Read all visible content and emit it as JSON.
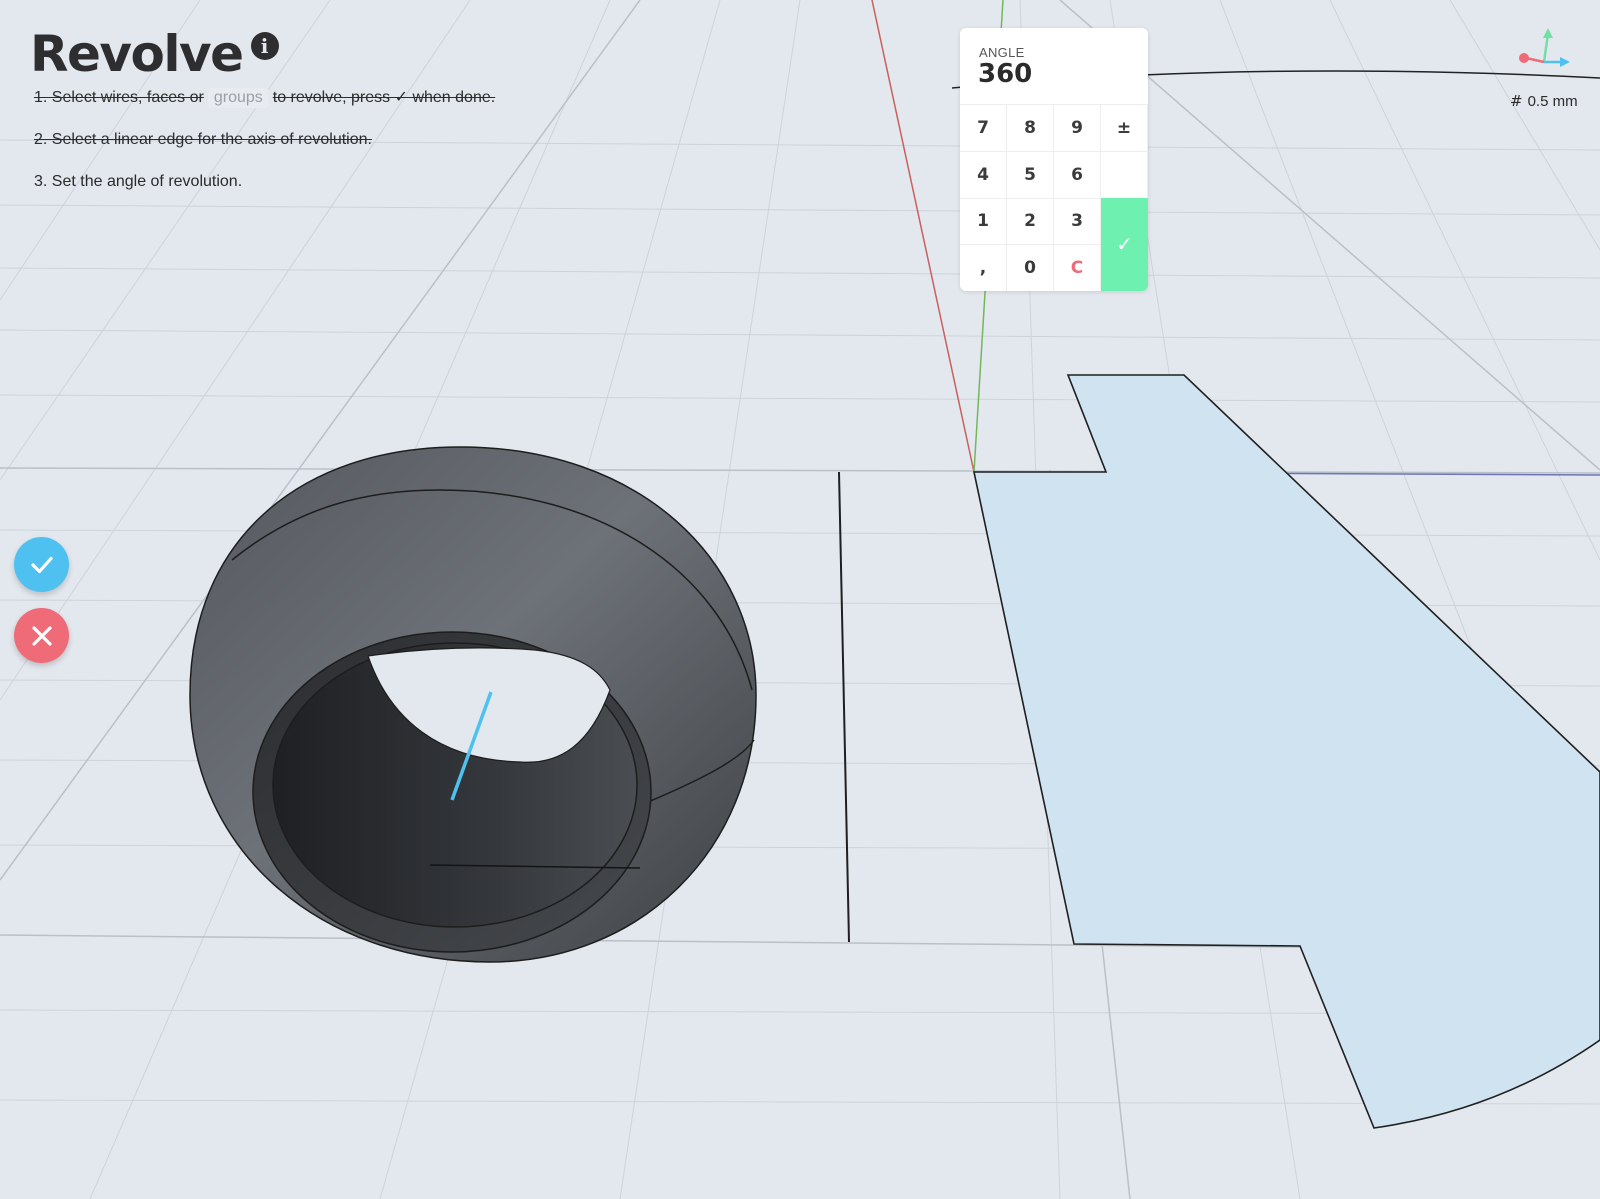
{
  "header": {
    "title": "Revolve",
    "info_icon": "info-icon"
  },
  "steps": {
    "step1_a": "1. Select wires, faces or",
    "step1_chip": "groups",
    "step1_b": "to revolve, press ✓ when done.",
    "step2": "2. Select a linear edge for the axis of revolution.",
    "step3": "3. Set the angle of revolution."
  },
  "actions": {
    "confirm_icon": "checkmark-icon",
    "cancel_icon": "close-icon",
    "confirm_color": "#4fc1f0",
    "cancel_color": "#ef6b78"
  },
  "keypad": {
    "label": "ANGLE",
    "value": "360",
    "keys": {
      "k7": "7",
      "k8": "8",
      "k9": "9",
      "kpm": "±",
      "k4": "4",
      "k5": "5",
      "k6": "6",
      "k1": "1",
      "k2": "2",
      "k3": "3",
      "kcomma": ",",
      "k0": "0",
      "kclear": "C",
      "kconfirm": "✓"
    },
    "confirm_color": "#6ef0b1"
  },
  "status": {
    "grid_icon": "grid-icon",
    "grid_symbol": "#",
    "grid_size": "0.5 mm"
  },
  "colors": {
    "background": "#e3e8ee",
    "axis_x": "#c8605c",
    "axis_y": "#72b85a",
    "axis_z": "#4fc1f0",
    "profile_fill": "#cfe3f1",
    "solid_dark": "#3a3d41"
  }
}
